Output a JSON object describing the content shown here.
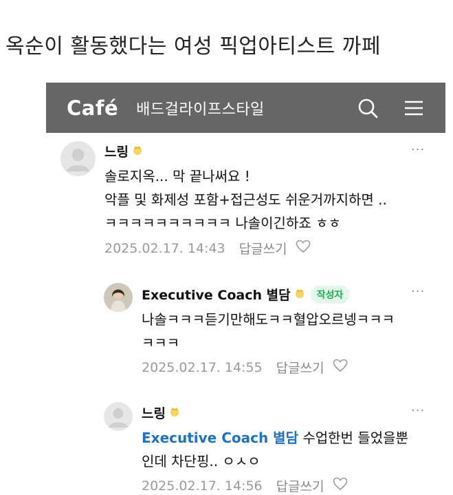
{
  "headline": "옥순이 활동했다는 여성 픽업아티스트 까페",
  "appbar": {
    "logo": "Café",
    "cafe_name": "배드걸라이프스타일",
    "search_icon": "search-icon",
    "menu_icon": "menu-icon"
  },
  "comments": [
    {
      "author": "느링",
      "lines": [
        "솔로지옥... 막 끝나써요 !",
        "악플 및 화제성 포함+접근성도 쉬운거까지하면 ..",
        "ㅋㅋㅋㅋㅋㅋㅋㅋㅋㅋ 나솔이긴하죠 ㅎㅎ"
      ],
      "date": "2025.02.17. 14:43",
      "reply": "답글쓰기",
      "more": "···"
    },
    {
      "author": "Executive Coach 별담",
      "tag": "작성자",
      "lines": [
        "나솔ㅋㅋㅋ듣기만해도ㅋㅋ혈압오르넹ㅋㅋㅋ",
        "ㅋㅋㅋ"
      ],
      "date": "2025.02.17. 14:55",
      "reply": "답글쓰기",
      "more": "···"
    },
    {
      "author": "느링",
      "mention": "Executive Coach 별담",
      "line1_rest": " 수업한번 들었을뿐",
      "line2": "인데 차단핑.. ㅇㅅㅇ",
      "date": "2025.02.17. 14:56",
      "reply": "답글쓰기",
      "more": "···"
    }
  ],
  "colors": {
    "appbar": "#666666",
    "author_tag_bg": "#e3f6ea",
    "author_tag_text": "#1fae56",
    "mention": "#1a73c8"
  }
}
